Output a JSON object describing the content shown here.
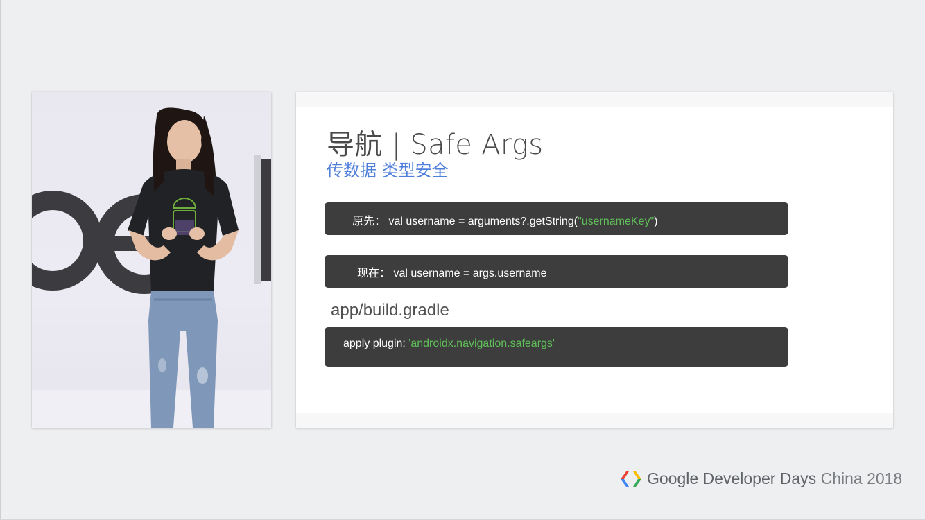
{
  "slide": {
    "title": "导航 | Safe Args",
    "subtitle": "传数据 类型安全",
    "before": {
      "label": "原先：",
      "code": "val username = arguments?.getString(",
      "string": "\"usernameKey\"",
      "suffix": ")"
    },
    "after": {
      "label": "现在：",
      "code": "val username = args.username"
    },
    "gradle_file": "app/build.gradle",
    "plugin": {
      "code": "apply plugin: ",
      "string": "'androidx.navigation.safeargs'"
    }
  },
  "footer": {
    "brand": "Google Developer Days",
    "suffix": "China 2018",
    "logo_icon": "gdd-chevrons-icon",
    "logo_colors": [
      "#ea4335",
      "#4285f4",
      "#fbbc05",
      "#34a853"
    ]
  },
  "video": {
    "description_icon": "speaker-video-feed"
  },
  "colors": {
    "background": "#eeeff1",
    "code_bg": "#3d3d3d",
    "string": "#5fbf58",
    "subtitle": "#4f7fda"
  }
}
